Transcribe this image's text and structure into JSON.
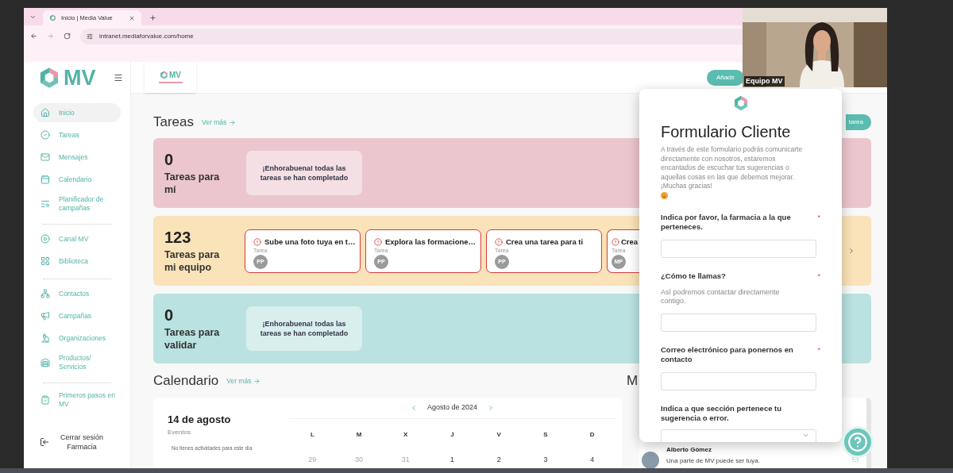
{
  "browser": {
    "tab": {
      "title": "Inicio | Media Value"
    },
    "url": "intranet.mediaforvalue.com/home"
  },
  "header": {
    "logo_text": "MV",
    "badge_logo_text": "MV",
    "add_button": "Añadir"
  },
  "sidebar": {
    "groups": [
      {
        "items": [
          {
            "label": "Inicio",
            "selected": true
          },
          {
            "label": "Tareas",
            "selected": false
          },
          {
            "label": "Mensajes",
            "selected": false
          },
          {
            "label": "Calendario",
            "selected": false
          },
          {
            "label": "Planificador de campañas",
            "selected": false
          }
        ]
      },
      {
        "items": [
          {
            "label": "Canal MV",
            "selected": false
          },
          {
            "label": "Biblioteca",
            "selected": false
          }
        ]
      },
      {
        "items": [
          {
            "label": "Contactos",
            "selected": false
          },
          {
            "label": "Campañas",
            "selected": false
          },
          {
            "label": "Organizaciones",
            "selected": false
          },
          {
            "label": "Productos/ Servicios",
            "selected": false
          }
        ]
      },
      {
        "items": [
          {
            "label": "Primeros pasos en MV",
            "selected": false
          }
        ]
      }
    ],
    "logout": {
      "label": "Cerrar sesión",
      "account": "Farmacia"
    }
  },
  "tasks": {
    "title": "Tareas",
    "more": "Ver más",
    "new_button": "tarea",
    "sections": [
      {
        "kind": "empty",
        "color": "#ecc6ce",
        "count": "0",
        "label": "Tareas para mí",
        "message": "¡Enhorabuena! todas las tareas se han completado"
      },
      {
        "kind": "list",
        "color": "#fae3b8",
        "count": "123",
        "label": "Tareas para mi equipo",
        "tasks": [
          {
            "title": "Sube una foto tuya en t…",
            "type": "Tarea",
            "initials": "PP"
          },
          {
            "title": "Explora las formacione…",
            "type": "Tarea",
            "initials": "PP"
          },
          {
            "title": "Crea una tarea para ti",
            "type": "Tarea",
            "initials": "PP"
          },
          {
            "title": "Crea",
            "type": "Tarea",
            "initials": "MP"
          }
        ]
      },
      {
        "kind": "empty",
        "color": "#b9e2e0",
        "count": "0",
        "label": "Tareas para validar",
        "message": "¡Enhorabuena! todas las tareas se han completado"
      }
    ]
  },
  "calendar": {
    "title": "Calendario",
    "more": "Ver más",
    "date": "14 de agosto",
    "events_label": "Eventos",
    "empty": "No tienes actividades para este día",
    "month": "Agosto de 2024",
    "weekdays": [
      "L",
      "M",
      "X",
      "J",
      "V",
      "S",
      "D"
    ],
    "days": [
      {
        "label": "29",
        "in_month": false
      },
      {
        "label": "30",
        "in_month": false
      },
      {
        "label": "31",
        "in_month": false
      },
      {
        "label": "1",
        "in_month": true
      },
      {
        "label": "2",
        "in_month": true
      },
      {
        "label": "3",
        "in_month": true
      },
      {
        "label": "4",
        "in_month": true
      }
    ]
  },
  "messages": {
    "title": "M",
    "items": [
      {
        "name": "Alberto Gómez",
        "text": "Una parte de MV puede ser tuya."
      }
    ]
  },
  "form": {
    "title": "Formulario Cliente",
    "description": "A través de este formulario podrás comunicarte directamente con nosotros, estaremos encantados de escuchar tus sugerencias o aquellas cosas en las que debemos mejorar. ¡Muchas gracias!",
    "fields": [
      {
        "kind": "text",
        "label": "Indica por favor, la farmacia a la que perteneces.",
        "required_mark": "*"
      },
      {
        "kind": "text",
        "label": "¿Cómo te llamas?",
        "required_mark": "*",
        "hint": "Así podremos contactar directamente contigo."
      },
      {
        "kind": "text",
        "label": "Correo electrónico para ponernos en contacto",
        "required_mark": "*"
      },
      {
        "kind": "select",
        "label": "Indica a que sección pertenece tu sugerencia o error."
      }
    ]
  },
  "video": {
    "label": "Equipo MV"
  }
}
